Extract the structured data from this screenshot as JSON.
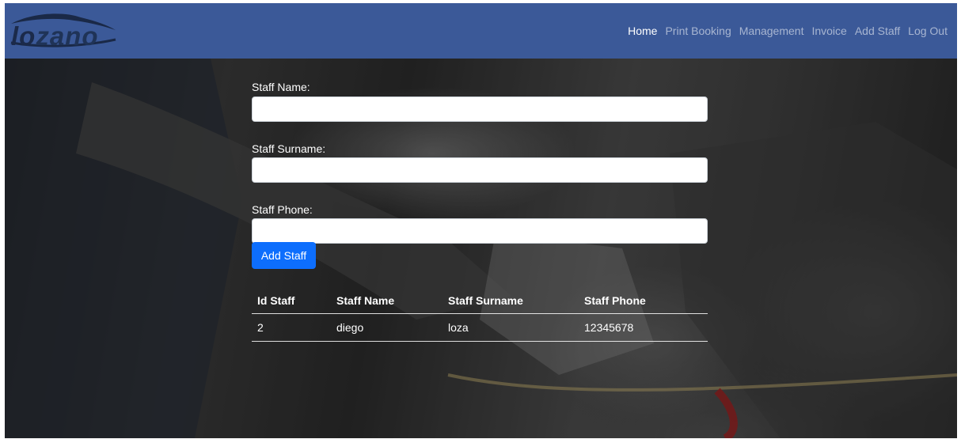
{
  "brand": {
    "logo_part1": "lo",
    "logo_part2": "zano"
  },
  "nav": [
    {
      "label": "Home",
      "active": true
    },
    {
      "label": "Print Booking",
      "active": false
    },
    {
      "label": "Management",
      "active": false
    },
    {
      "label": "Invoice",
      "active": false
    },
    {
      "label": "Add Staff",
      "active": false
    },
    {
      "label": "Log Out",
      "active": false
    }
  ],
  "form": {
    "name_label": "Staff Name:",
    "name_value": "",
    "surname_label": "Staff Surname:",
    "surname_value": "",
    "phone_label": "Staff Phone:",
    "phone_value": "",
    "submit_label": "Add Staff"
  },
  "table": {
    "headers": [
      "Id Staff",
      "Staff Name",
      "Staff Surname",
      "Staff Phone"
    ],
    "rows": [
      [
        "2",
        "diego",
        "loza",
        "12345678"
      ]
    ]
  },
  "colors": {
    "navbar": "#3b5998",
    "button": "#0d6efd",
    "active_link": "#ffffff"
  }
}
